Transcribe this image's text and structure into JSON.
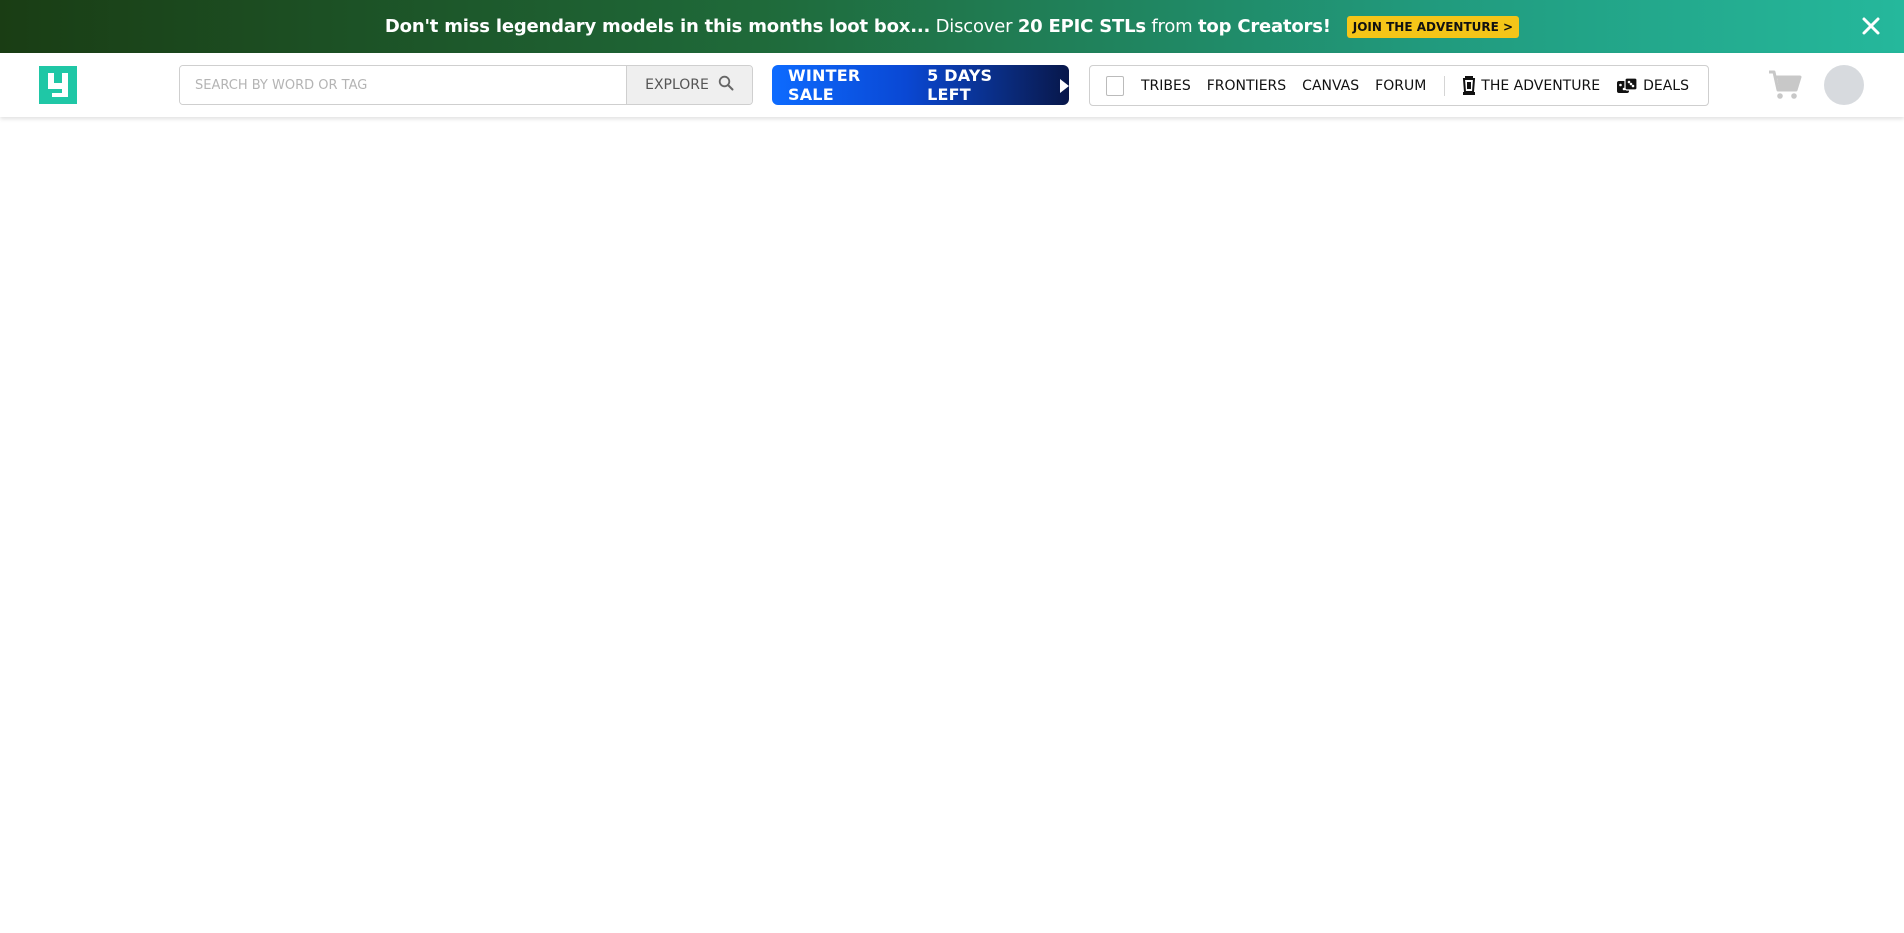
{
  "banner": {
    "text_bold1": "Don't miss legendary models in this months loot box...",
    "text_regular1": " Discover ",
    "text_bold2": "20 EPIC STLs",
    "text_regular2": " from ",
    "text_bold3": "top Creators!",
    "cta_label": "JOIN THE ADVENTURE >",
    "close_icon": "close-icon",
    "colors": {
      "gradient_start": "#1a3d14",
      "gradient_end": "#25b89c",
      "cta_bg": "#f5c518"
    }
  },
  "header": {
    "logo_icon": "brand-logo-icon",
    "logo_color": "#1fc7a6",
    "search": {
      "placeholder": "SEARCH BY WORD OR TAG",
      "value": "",
      "button_label": "EXPLORE",
      "button_icon": "search-icon"
    },
    "sale": {
      "label": "WINTER SALE",
      "countdown": "5 DAYS LEFT",
      "icon": "play-arrow-icon"
    },
    "nav": {
      "items": [
        {
          "label": "TRIBES"
        },
        {
          "label": "FRONTIERS"
        },
        {
          "label": "CANVAS"
        },
        {
          "label": "FORUM"
        }
      ],
      "adventure_label": "THE ADVENTURE",
      "adventure_icon": "lantern-icon",
      "deals_label": "DEALS",
      "deals_icon": "dice-icon"
    },
    "cart_icon": "cart-icon",
    "avatar_icon": "avatar"
  }
}
